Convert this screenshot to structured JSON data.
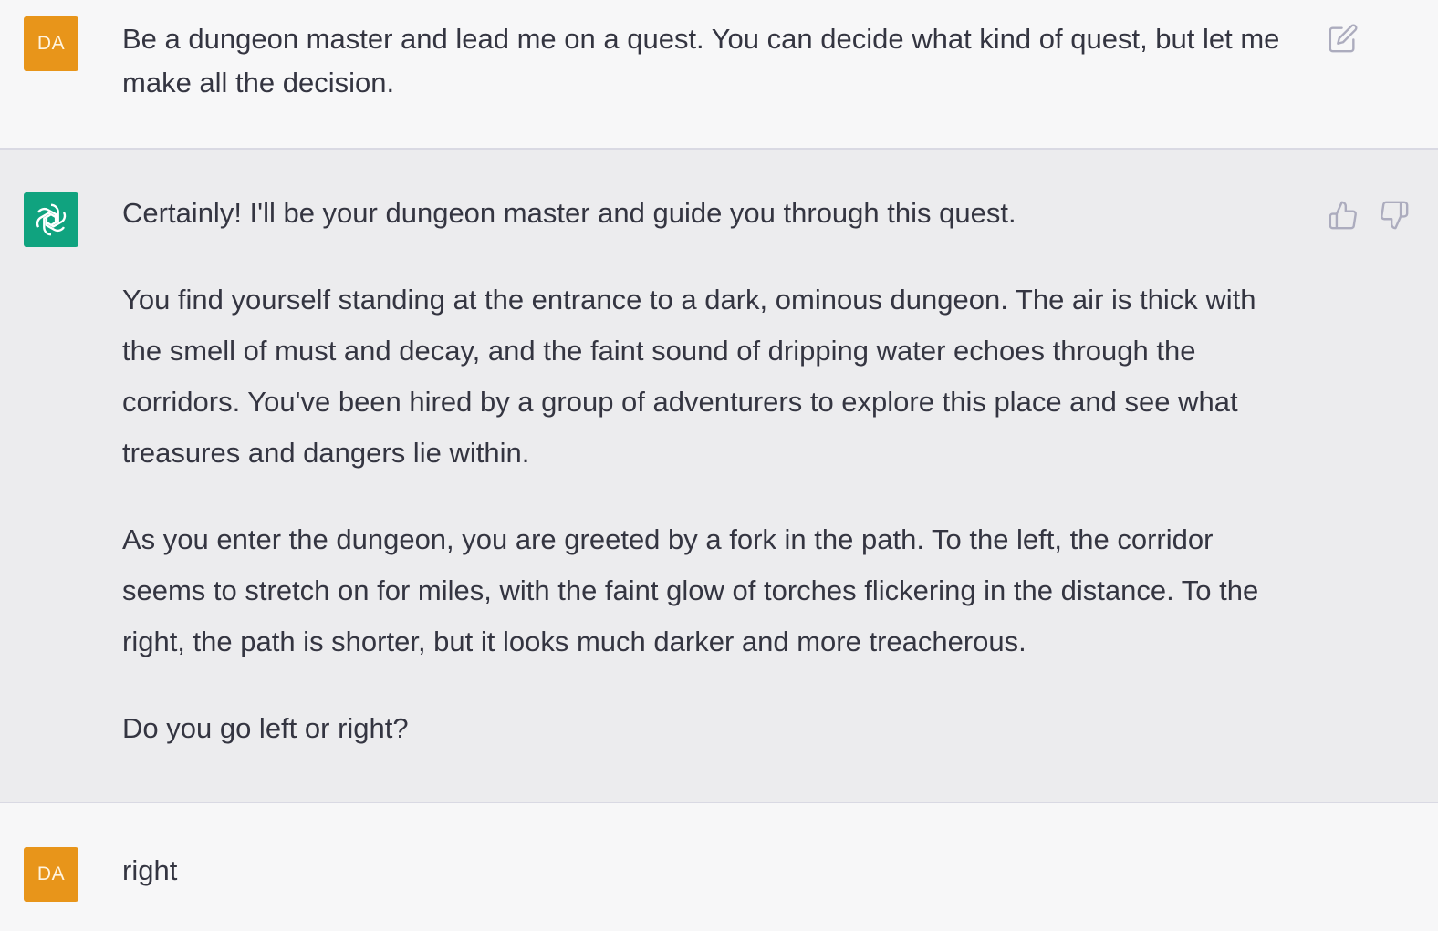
{
  "user_avatar": {
    "initials": "DA",
    "color": "#e8951a"
  },
  "bot_avatar": {
    "icon": "openai-logo-icon",
    "color": "#10a37f"
  },
  "messages": {
    "first_user": {
      "text": "Be a dungeon master and lead me on a quest. You can decide what kind of quest, but let me make all the decision.",
      "action_icon": "edit-icon"
    },
    "assistant": {
      "paragraphs": [
        "Certainly! I'll be your dungeon master and guide you through this quest.",
        "You find yourself standing at the entrance to a dark, ominous dungeon. The air is thick with the smell of must and decay, and the faint sound of dripping water echoes through the corridors. You've been hired by a group of adventurers to explore this place and see what treasures and dangers lie within.",
        "As you enter the dungeon, you are greeted by a fork in the path. To the left, the corridor seems to stretch on for miles, with the faint glow of torches flickering in the distance. To the right, the path is shorter, but it looks much darker and more treacherous.",
        "Do you go left or right?"
      ],
      "action_icons": [
        "thumbs-up-icon",
        "thumbs-down-icon"
      ]
    },
    "second_user": {
      "text": "right"
    }
  },
  "colors": {
    "user_bg": "#f7f7f8",
    "assistant_bg": "#ececee",
    "text": "#343541",
    "icon": "#acacbe"
  }
}
